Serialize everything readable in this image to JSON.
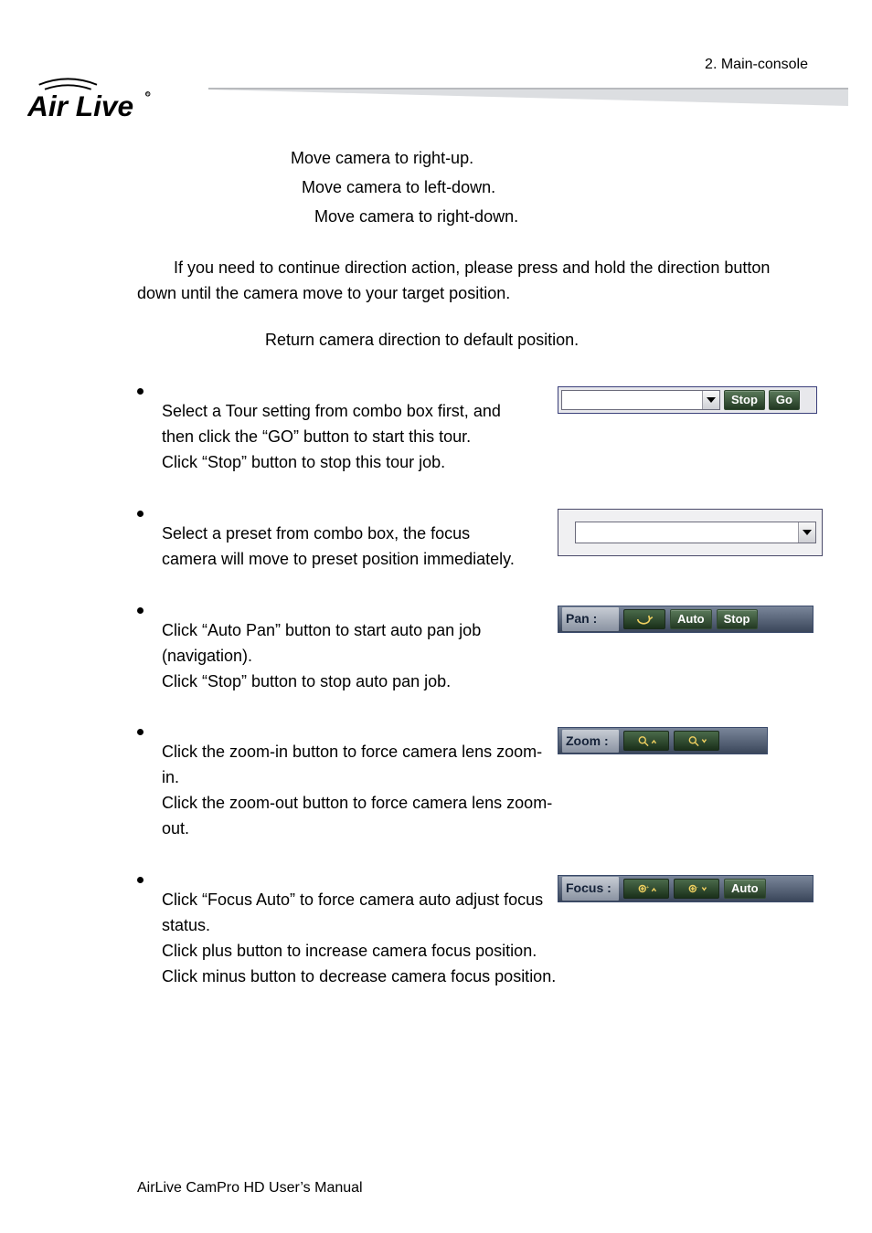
{
  "header": {
    "crumb": "2. Main-console",
    "brand": "Air Live"
  },
  "directions": {
    "right_up": "Move camera to right-up.",
    "left_down": "Move camera to left-down.",
    "right_down": "Move camera to right-down."
  },
  "continue_note": "If you need to continue direction action, please press and hold the direction button down until the camera move to your target position.",
  "return_default": "Return camera direction to default position.",
  "tour": {
    "line1": "Select a Tour setting from combo box first, and then click the “GO” button to start this tour.",
    "line2": "Click “Stop” button to stop this tour job.",
    "stop_label": "Stop",
    "go_label": "Go"
  },
  "preset": {
    "text": "Select a preset from combo box, the focus camera will move to preset position immediately."
  },
  "pan": {
    "line1": "Click “Auto Pan” button to start auto pan job (navigation).",
    "line2": "Click “Stop” button to stop auto pan job.",
    "label": "Pan :",
    "auto_label": "Auto",
    "stop_label": "Stop"
  },
  "zoom": {
    "line1": "Click the zoom-in button to force camera lens zoom-in.",
    "line2": "Click the zoom-out button to force camera lens zoom-out.",
    "label": "Zoom :"
  },
  "focus": {
    "line1": "Click “Focus Auto” to force camera auto adjust focus status.",
    "line2": "Click plus button to increase camera focus position.",
    "line3": "Click minus button to decrease camera focus position.",
    "label": "Focus :",
    "auto_label": "Auto"
  },
  "footer": "AirLive CamPro HD User’s Manual"
}
